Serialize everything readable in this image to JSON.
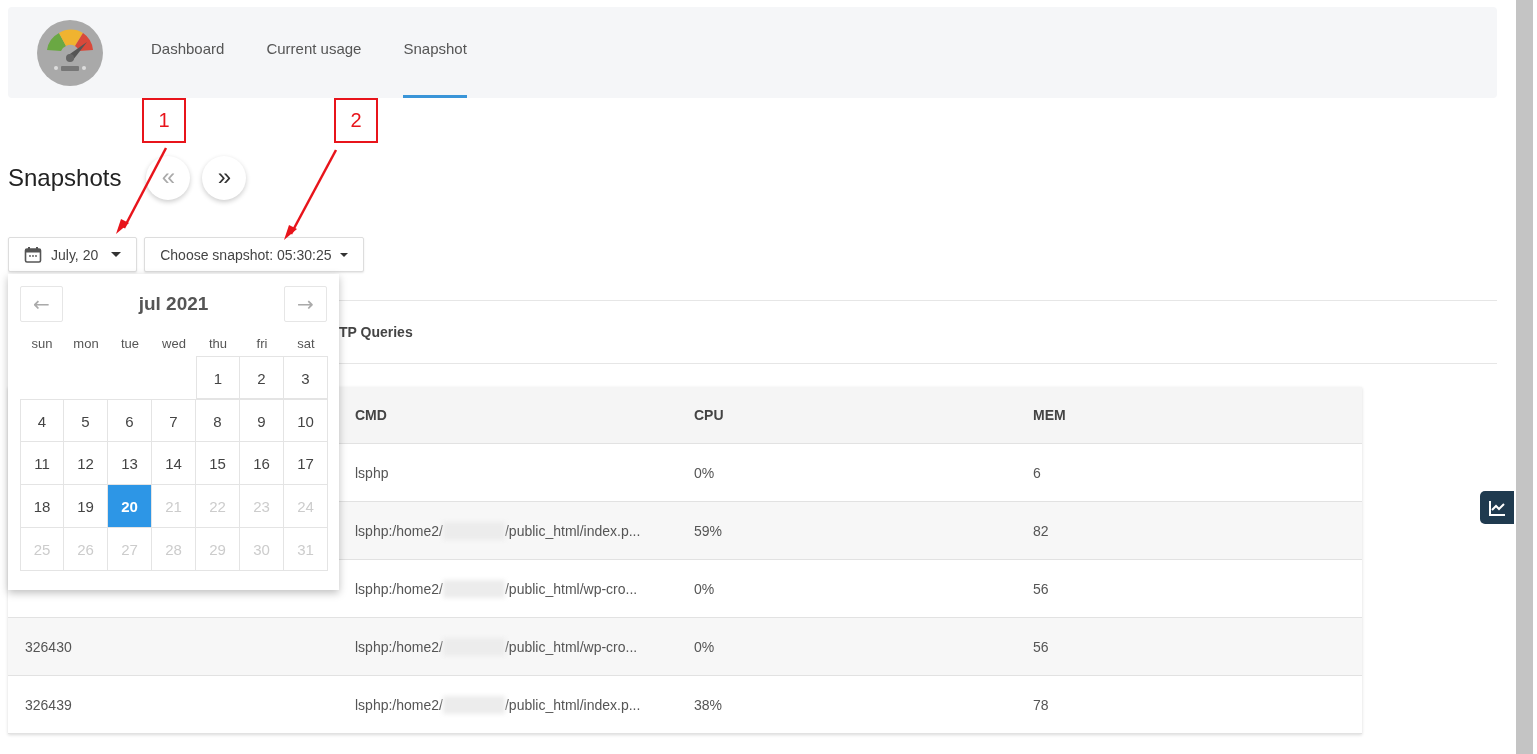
{
  "nav": {
    "items": [
      {
        "label": "Dashboard",
        "selected": false
      },
      {
        "label": "Current usage",
        "selected": false
      },
      {
        "label": "Snapshot",
        "selected": true
      }
    ]
  },
  "page": {
    "title": "Snapshots",
    "prev": "«",
    "next": "»"
  },
  "filters": {
    "date": "July, 20",
    "snapshot": "Choose snapshot: 05:30:25"
  },
  "tabs": [
    {
      "label": "TP Queries",
      "selected": false
    }
  ],
  "table": {
    "columns": [
      "CMD",
      "CPU",
      "MEM"
    ],
    "rows": [
      {
        "pid": "",
        "cmd": [
          {
            "kind": "text",
            "text": "lsphp"
          }
        ],
        "cpu": "0%",
        "mem": "6"
      },
      {
        "pid": "",
        "cmd": [
          {
            "kind": "text",
            "text": "lsphp:/home2/"
          },
          {
            "kind": "redacted"
          },
          {
            "kind": "text",
            "text": "/public_html/index.p..."
          }
        ],
        "cpu": "59%",
        "mem": "82"
      },
      {
        "pid": "",
        "cmd": [
          {
            "kind": "text",
            "text": "lsphp:/home2/"
          },
          {
            "kind": "redacted"
          },
          {
            "kind": "text",
            "text": "/public_html/wp-cro..."
          }
        ],
        "cpu": "0%",
        "mem": "56"
      },
      {
        "pid": "326430",
        "cmd": [
          {
            "kind": "text",
            "text": "lsphp:/home2/"
          },
          {
            "kind": "redacted"
          },
          {
            "kind": "text",
            "text": "/public_html/wp-cro..."
          }
        ],
        "cpu": "0%",
        "mem": "56"
      },
      {
        "pid": "326439",
        "cmd": [
          {
            "kind": "text",
            "text": "lsphp:/home2/"
          },
          {
            "kind": "redacted"
          },
          {
            "kind": "text",
            "text": "/public_html/index.p..."
          }
        ],
        "cpu": "38%",
        "mem": "78"
      }
    ]
  },
  "calendar": {
    "title": "jul 2021",
    "prev": "←",
    "next": "→",
    "weekdays": [
      "sun",
      "mon",
      "tue",
      "wed",
      "thu",
      "fri",
      "sat"
    ],
    "weeks": [
      [
        {
          "kind": "empty"
        },
        {
          "kind": "empty"
        },
        {
          "kind": "empty"
        },
        {
          "kind": "empty"
        },
        {
          "kind": "day",
          "day": "1",
          "selected": false,
          "disabled": false
        },
        {
          "kind": "day",
          "day": "2",
          "selected": false,
          "disabled": false
        },
        {
          "kind": "day",
          "day": "3",
          "selected": false,
          "disabled": false
        }
      ],
      [
        {
          "kind": "day",
          "day": "4",
          "selected": false,
          "disabled": false
        },
        {
          "kind": "day",
          "day": "5",
          "selected": false,
          "disabled": false
        },
        {
          "kind": "day",
          "day": "6",
          "selected": false,
          "disabled": false
        },
        {
          "kind": "day",
          "day": "7",
          "selected": false,
          "disabled": false
        },
        {
          "kind": "day",
          "day": "8",
          "selected": false,
          "disabled": false
        },
        {
          "kind": "day",
          "day": "9",
          "selected": false,
          "disabled": false
        },
        {
          "kind": "day",
          "day": "10",
          "selected": false,
          "disabled": false
        }
      ],
      [
        {
          "kind": "day",
          "day": "11",
          "selected": false,
          "disabled": false
        },
        {
          "kind": "day",
          "day": "12",
          "selected": false,
          "disabled": false
        },
        {
          "kind": "day",
          "day": "13",
          "selected": false,
          "disabled": false
        },
        {
          "kind": "day",
          "day": "14",
          "selected": false,
          "disabled": false
        },
        {
          "kind": "day",
          "day": "15",
          "selected": false,
          "disabled": false
        },
        {
          "kind": "day",
          "day": "16",
          "selected": false,
          "disabled": false
        },
        {
          "kind": "day",
          "day": "17",
          "selected": false,
          "disabled": false
        }
      ],
      [
        {
          "kind": "day",
          "day": "18",
          "selected": false,
          "disabled": false
        },
        {
          "kind": "day",
          "day": "19",
          "selected": false,
          "disabled": false
        },
        {
          "kind": "day",
          "day": "20",
          "selected": true,
          "disabled": false
        },
        {
          "kind": "day",
          "day": "21",
          "selected": false,
          "disabled": true
        },
        {
          "kind": "day",
          "day": "22",
          "selected": false,
          "disabled": true
        },
        {
          "kind": "day",
          "day": "23",
          "selected": false,
          "disabled": true
        },
        {
          "kind": "day",
          "day": "24",
          "selected": false,
          "disabled": true
        }
      ],
      [
        {
          "kind": "day",
          "day": "25",
          "selected": false,
          "disabled": true
        },
        {
          "kind": "day",
          "day": "26",
          "selected": false,
          "disabled": true
        },
        {
          "kind": "day",
          "day": "27",
          "selected": false,
          "disabled": true
        },
        {
          "kind": "day",
          "day": "28",
          "selected": false,
          "disabled": true
        },
        {
          "kind": "day",
          "day": "29",
          "selected": false,
          "disabled": true
        },
        {
          "kind": "day",
          "day": "30",
          "selected": false,
          "disabled": true
        },
        {
          "kind": "day",
          "day": "31",
          "selected": false,
          "disabled": true
        }
      ]
    ]
  },
  "annotations": [
    {
      "label": "1"
    },
    {
      "label": "2"
    }
  ]
}
